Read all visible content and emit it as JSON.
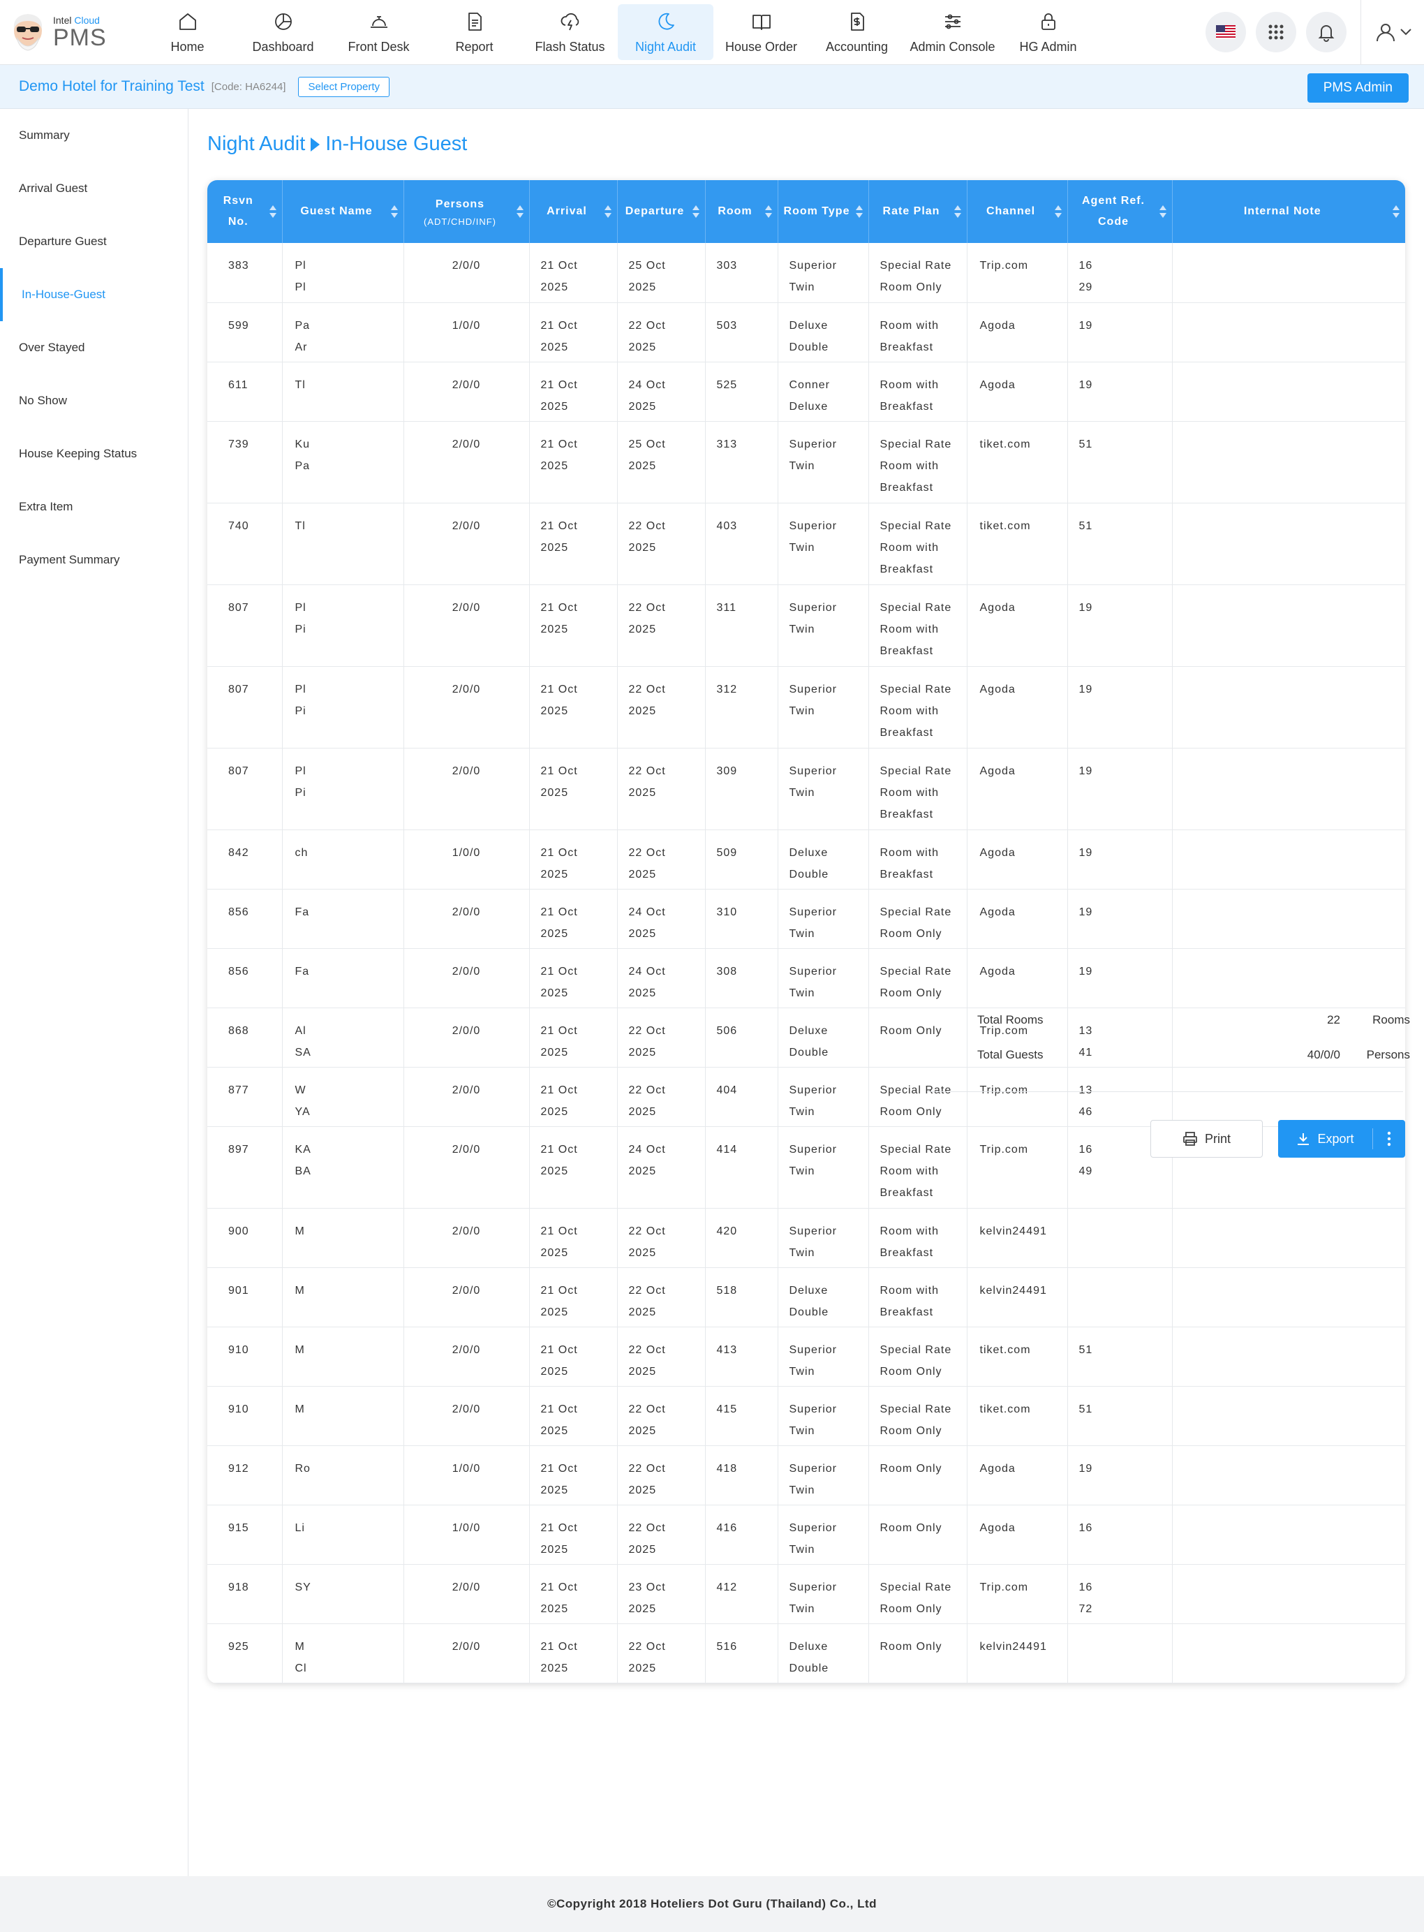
{
  "brand": {
    "small_prefix": "Intel",
    "small_accent": "Cloud",
    "big": "PMS"
  },
  "nav": [
    {
      "label": "Home",
      "icon": "home-icon"
    },
    {
      "label": "Dashboard",
      "icon": "pie-chart-icon"
    },
    {
      "label": "Front Desk",
      "icon": "bell-desk-icon"
    },
    {
      "label": "Report",
      "icon": "document-icon"
    },
    {
      "label": "Flash Status",
      "icon": "cloud-lightning-icon"
    },
    {
      "label": "Night Audit",
      "icon": "moon-icon"
    },
    {
      "label": "House Order",
      "icon": "book-icon"
    },
    {
      "label": "Accounting",
      "icon": "dollar-doc-icon"
    },
    {
      "label": "Admin Console",
      "icon": "sliders-icon"
    },
    {
      "label": "HG Admin",
      "icon": "lock-icon"
    }
  ],
  "active_nav": "Night Audit",
  "property": {
    "name": "Demo Hotel for Training Test",
    "code": "[Code: HA6244]",
    "select_label": "Select Property",
    "admin_label": "PMS Admin"
  },
  "sidebar": [
    "Summary",
    "Arrival Guest",
    "Departure Guest",
    "In-House-Guest",
    "Over Stayed",
    "No Show",
    "House Keeping Status",
    "Extra Item",
    "Payment Summary"
  ],
  "active_sidebar": "In-House-Guest",
  "breadcrumb": {
    "parent": "Night Audit",
    "current": "In-House Guest"
  },
  "table": {
    "headers": [
      {
        "label": "Rsvn No."
      },
      {
        "label": "Guest Name"
      },
      {
        "label": "Persons",
        "sub": "(ADT/CHD/INF)"
      },
      {
        "label": "Arrival"
      },
      {
        "label": "Departure"
      },
      {
        "label": "Room"
      },
      {
        "label": "Room Type"
      },
      {
        "label": "Rate Plan"
      },
      {
        "label": "Channel"
      },
      {
        "label": "Agent Ref. Code"
      },
      {
        "label": "Internal Note"
      }
    ],
    "rows": [
      {
        "rsvn": "383",
        "guest": [
          "Pl",
          "Pl"
        ],
        "persons": "2/0/0",
        "arrival": [
          "21 Oct",
          "2025"
        ],
        "departure": [
          "25 Oct",
          "2025"
        ],
        "room": "303",
        "type": [
          "Superior",
          "Twin"
        ],
        "rate": [
          "Special Rate",
          "Room Only"
        ],
        "channel": "Trip.com",
        "agent": [
          "16",
          "29"
        ],
        "note": ""
      },
      {
        "rsvn": "599",
        "guest": [
          "Pa",
          "Ar"
        ],
        "persons": "1/0/0",
        "arrival": [
          "21 Oct",
          "2025"
        ],
        "departure": [
          "22 Oct",
          "2025"
        ],
        "room": "503",
        "type": [
          "Deluxe",
          "Double"
        ],
        "rate": [
          "Room with",
          "Breakfast"
        ],
        "channel": "Agoda",
        "agent": [
          "19"
        ],
        "note": ""
      },
      {
        "rsvn": "611",
        "guest": [
          "Tl"
        ],
        "persons": "2/0/0",
        "arrival": [
          "21 Oct",
          "2025"
        ],
        "departure": [
          "24 Oct",
          "2025"
        ],
        "room": "525",
        "type": [
          "Conner",
          "Deluxe"
        ],
        "rate": [
          "Room with",
          "Breakfast"
        ],
        "channel": "Agoda",
        "agent": [
          "19"
        ],
        "note": ""
      },
      {
        "rsvn": "739",
        "guest": [
          "Ku",
          "Pa"
        ],
        "persons": "2/0/0",
        "arrival": [
          "21 Oct",
          "2025"
        ],
        "departure": [
          "25 Oct",
          "2025"
        ],
        "room": "313",
        "type": [
          "Superior",
          "Twin"
        ],
        "rate": [
          "Special Rate",
          "Room with",
          "Breakfast"
        ],
        "channel": "tiket.com",
        "agent": [
          "51"
        ],
        "note": ""
      },
      {
        "rsvn": "740",
        "guest": [
          "Tl"
        ],
        "persons": "2/0/0",
        "arrival": [
          "21 Oct",
          "2025"
        ],
        "departure": [
          "22 Oct",
          "2025"
        ],
        "room": "403",
        "type": [
          "Superior",
          "Twin"
        ],
        "rate": [
          "Special Rate",
          "Room with",
          "Breakfast"
        ],
        "channel": "tiket.com",
        "agent": [
          "51"
        ],
        "note": ""
      },
      {
        "rsvn": "807",
        "guest": [
          "Pl",
          "Pi"
        ],
        "persons": "2/0/0",
        "arrival": [
          "21 Oct",
          "2025"
        ],
        "departure": [
          "22 Oct",
          "2025"
        ],
        "room": "311",
        "type": [
          "Superior",
          "Twin"
        ],
        "rate": [
          "Special Rate",
          "Room with",
          "Breakfast"
        ],
        "channel": "Agoda",
        "agent": [
          "19"
        ],
        "note": ""
      },
      {
        "rsvn": "807",
        "guest": [
          "Pl",
          "Pi"
        ],
        "persons": "2/0/0",
        "arrival": [
          "21 Oct",
          "2025"
        ],
        "departure": [
          "22 Oct",
          "2025"
        ],
        "room": "312",
        "type": [
          "Superior",
          "Twin"
        ],
        "rate": [
          "Special Rate",
          "Room with",
          "Breakfast"
        ],
        "channel": "Agoda",
        "agent": [
          "19"
        ],
        "note": ""
      },
      {
        "rsvn": "807",
        "guest": [
          "Pl",
          "Pi"
        ],
        "persons": "2/0/0",
        "arrival": [
          "21 Oct",
          "2025"
        ],
        "departure": [
          "22 Oct",
          "2025"
        ],
        "room": "309",
        "type": [
          "Superior",
          "Twin"
        ],
        "rate": [
          "Special Rate",
          "Room with",
          "Breakfast"
        ],
        "channel": "Agoda",
        "agent": [
          "19"
        ],
        "note": ""
      },
      {
        "rsvn": "842",
        "guest": [
          "ch"
        ],
        "persons": "1/0/0",
        "arrival": [
          "21 Oct",
          "2025"
        ],
        "departure": [
          "22 Oct",
          "2025"
        ],
        "room": "509",
        "type": [
          "Deluxe",
          "Double"
        ],
        "rate": [
          "Room with",
          "Breakfast"
        ],
        "channel": "Agoda",
        "agent": [
          "19"
        ],
        "note": ""
      },
      {
        "rsvn": "856",
        "guest": [
          "Fa"
        ],
        "persons": "2/0/0",
        "arrival": [
          "21 Oct",
          "2025"
        ],
        "departure": [
          "24 Oct",
          "2025"
        ],
        "room": "310",
        "type": [
          "Superior",
          "Twin"
        ],
        "rate": [
          "Special Rate",
          "Room Only"
        ],
        "channel": "Agoda",
        "agent": [
          "19"
        ],
        "note": ""
      },
      {
        "rsvn": "856",
        "guest": [
          "Fa"
        ],
        "persons": "2/0/0",
        "arrival": [
          "21 Oct",
          "2025"
        ],
        "departure": [
          "24 Oct",
          "2025"
        ],
        "room": "308",
        "type": [
          "Superior",
          "Twin"
        ],
        "rate": [
          "Special Rate",
          "Room Only"
        ],
        "channel": "Agoda",
        "agent": [
          "19"
        ],
        "note": ""
      },
      {
        "rsvn": "868",
        "guest": [
          "Al",
          "SA"
        ],
        "persons": "2/0/0",
        "arrival": [
          "21 Oct",
          "2025"
        ],
        "departure": [
          "22 Oct",
          "2025"
        ],
        "room": "506",
        "type": [
          "Deluxe",
          "Double"
        ],
        "rate": [
          "Room Only"
        ],
        "channel": "Trip.com",
        "agent": [
          "13",
          "41"
        ],
        "note": ""
      },
      {
        "rsvn": "877",
        "guest": [
          "W",
          "YA"
        ],
        "persons": "2/0/0",
        "arrival": [
          "21 Oct",
          "2025"
        ],
        "departure": [
          "22 Oct",
          "2025"
        ],
        "room": "404",
        "type": [
          "Superior",
          "Twin"
        ],
        "rate": [
          "Special Rate",
          "Room Only"
        ],
        "channel": "Trip.com",
        "agent": [
          "13",
          "46"
        ],
        "note": ""
      },
      {
        "rsvn": "897",
        "guest": [
          "KA",
          "BA"
        ],
        "persons": "2/0/0",
        "arrival": [
          "21 Oct",
          "2025"
        ],
        "departure": [
          "24 Oct",
          "2025"
        ],
        "room": "414",
        "type": [
          "Superior",
          "Twin"
        ],
        "rate": [
          "Special Rate",
          "Room with",
          "Breakfast"
        ],
        "channel": "Trip.com",
        "agent": [
          "16",
          "49"
        ],
        "note": ""
      },
      {
        "rsvn": "900",
        "guest": [
          "M"
        ],
        "persons": "2/0/0",
        "arrival": [
          "21 Oct",
          "2025"
        ],
        "departure": [
          "22 Oct",
          "2025"
        ],
        "room": "420",
        "type": [
          "Superior",
          "Twin"
        ],
        "rate": [
          "Room with",
          "Breakfast"
        ],
        "channel": "kelvin24491",
        "agent": [
          ""
        ],
        "note": ""
      },
      {
        "rsvn": "901",
        "guest": [
          "M"
        ],
        "persons": "2/0/0",
        "arrival": [
          "21 Oct",
          "2025"
        ],
        "departure": [
          "22 Oct",
          "2025"
        ],
        "room": "518",
        "type": [
          "Deluxe",
          "Double"
        ],
        "rate": [
          "Room with",
          "Breakfast"
        ],
        "channel": "kelvin24491",
        "agent": [
          ""
        ],
        "note": ""
      },
      {
        "rsvn": "910",
        "guest": [
          "M"
        ],
        "persons": "2/0/0",
        "arrival": [
          "21 Oct",
          "2025"
        ],
        "departure": [
          "22 Oct",
          "2025"
        ],
        "room": "413",
        "type": [
          "Superior",
          "Twin"
        ],
        "rate": [
          "Special Rate",
          "Room Only"
        ],
        "channel": "tiket.com",
        "agent": [
          "51"
        ],
        "note": ""
      },
      {
        "rsvn": "910",
        "guest": [
          "M"
        ],
        "persons": "2/0/0",
        "arrival": [
          "21 Oct",
          "2025"
        ],
        "departure": [
          "22 Oct",
          "2025"
        ],
        "room": "415",
        "type": [
          "Superior",
          "Twin"
        ],
        "rate": [
          "Special Rate",
          "Room Only"
        ],
        "channel": "tiket.com",
        "agent": [
          "51"
        ],
        "note": ""
      },
      {
        "rsvn": "912",
        "guest": [
          "Ro"
        ],
        "persons": "1/0/0",
        "arrival": [
          "21 Oct",
          "2025"
        ],
        "departure": [
          "22 Oct",
          "2025"
        ],
        "room": "418",
        "type": [
          "Superior",
          "Twin"
        ],
        "rate": [
          "Room Only"
        ],
        "channel": "Agoda",
        "agent": [
          "19"
        ],
        "note": ""
      },
      {
        "rsvn": "915",
        "guest": [
          "Li"
        ],
        "persons": "1/0/0",
        "arrival": [
          "21 Oct",
          "2025"
        ],
        "departure": [
          "22 Oct",
          "2025"
        ],
        "room": "416",
        "type": [
          "Superior",
          "Twin"
        ],
        "rate": [
          "Room Only"
        ],
        "channel": "Agoda",
        "agent": [
          "16"
        ],
        "note": ""
      },
      {
        "rsvn": "918",
        "guest": [
          "SY"
        ],
        "persons": "2/0/0",
        "arrival": [
          "21 Oct",
          "2025"
        ],
        "departure": [
          "23 Oct",
          "2025"
        ],
        "room": "412",
        "type": [
          "Superior",
          "Twin"
        ],
        "rate": [
          "Special Rate",
          "Room Only"
        ],
        "channel": "Trip.com",
        "agent": [
          "16",
          "72"
        ],
        "note": ""
      },
      {
        "rsvn": "925",
        "guest": [
          "M",
          "Cl"
        ],
        "persons": "2/0/0",
        "arrival": [
          "21 Oct",
          "2025"
        ],
        "departure": [
          "22 Oct",
          "2025"
        ],
        "room": "516",
        "type": [
          "Deluxe",
          "Double"
        ],
        "rate": [
          "Room Only"
        ],
        "channel": "kelvin24491",
        "agent": [
          ""
        ],
        "note": ""
      }
    ]
  },
  "totals": {
    "rooms_label": "Total Rooms",
    "rooms_value": "22",
    "rooms_unit": "Rooms",
    "guests_label": "Total Guests",
    "guests_value": "40/0/0",
    "guests_unit": "Persons"
  },
  "buttons": {
    "print": "Print",
    "export": "Export"
  },
  "footer": "©Copyright 2018 Hoteliers Dot Guru (Thailand) Co., Ltd",
  "colors": {
    "accent": "#2196f3",
    "header": "#3399f0"
  }
}
